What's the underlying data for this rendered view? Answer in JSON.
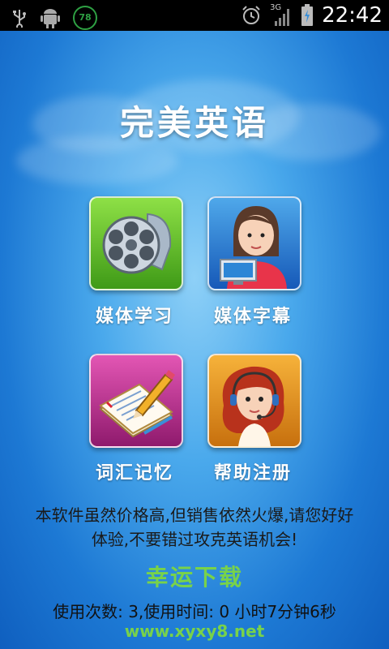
{
  "status_bar": {
    "battery_percent": "78",
    "network": "3G",
    "time": "22:42",
    "icons": [
      "usb-icon",
      "android-debug-icon",
      "battery-saver-icon",
      "alarm-icon",
      "signal-icon",
      "battery-icon"
    ]
  },
  "app": {
    "title": "完美英语"
  },
  "menu": [
    {
      "label": "媒体学习",
      "icon": "film-reel-icon"
    },
    {
      "label": "媒体字幕",
      "icon": "girl-computer-icon"
    },
    {
      "label": "词汇记忆",
      "icon": "notebook-pen-icon"
    },
    {
      "label": "帮助注册",
      "icon": "headset-girl-icon"
    }
  ],
  "notice": {
    "line1": "本软件虽然价格高,但销售依然火爆,请您好好",
    "line2": "体验,不要错过攻克英语机会!"
  },
  "watermark": {
    "text": "幸运下载",
    "url": "www.xyxy8.net"
  },
  "usage": {
    "text": "使用次数: 3,使用时间: 0 小时7分钟6秒"
  },
  "colors": {
    "bg_center": "#8ed0f7",
    "bg_edge": "#0f5fbf",
    "watermark": "#78d24a"
  }
}
